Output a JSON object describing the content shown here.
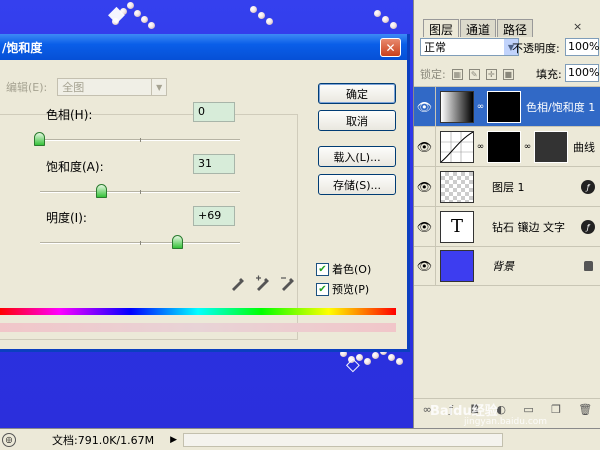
{
  "dialog": {
    "title": "/饱和度",
    "close_label": "✕",
    "edit_label": "编辑(E):",
    "edit_value": "全图",
    "hue_label": "色相(H):",
    "hue_value": "0",
    "hue_level": 0.0,
    "saturation_label": "饱和度(A):",
    "saturation_value": "31",
    "saturation_level": 0.31,
    "lightness_label": "明度(I):",
    "lightness_value": "+69",
    "lightness_level": 0.69,
    "buttons": {
      "ok": "确定",
      "cancel": "取消",
      "load": "载入(L)...",
      "save": "存储(S)..."
    },
    "colorize_label": "着色(O)",
    "colorize_checked": true,
    "preview_label": "预览(P)",
    "preview_checked": true
  },
  "layers_panel": {
    "tabs": [
      "图层",
      "通道",
      "路径"
    ],
    "active_tab": "图层",
    "blend_mode": "正常",
    "opacity_label": "不透明度:",
    "opacity_value": "100%",
    "lock_label": "锁定:",
    "fill_label": "填充:",
    "fill_value": "100%",
    "layers": [
      {
        "name": "色相/饱和度 1",
        "type": "adjustment",
        "selected": true
      },
      {
        "name": "曲线",
        "type": "adjustment",
        "selected": false
      },
      {
        "name": "图层 1",
        "type": "raster",
        "selected": false
      },
      {
        "name": "钻石 镶边 文字",
        "type": "text",
        "selected": false
      },
      {
        "name": "背景",
        "type": "background",
        "selected": false
      }
    ]
  },
  "status_bar": {
    "doc_info": "文档:791.0K/1.67M"
  },
  "watermark": {
    "logo": "Baidu经验",
    "url": "jingyan.baidu.com"
  },
  "colors": {
    "canvas": "#2c31e6",
    "selection": "#3169c6",
    "title_bar": "#0a5ee8"
  }
}
